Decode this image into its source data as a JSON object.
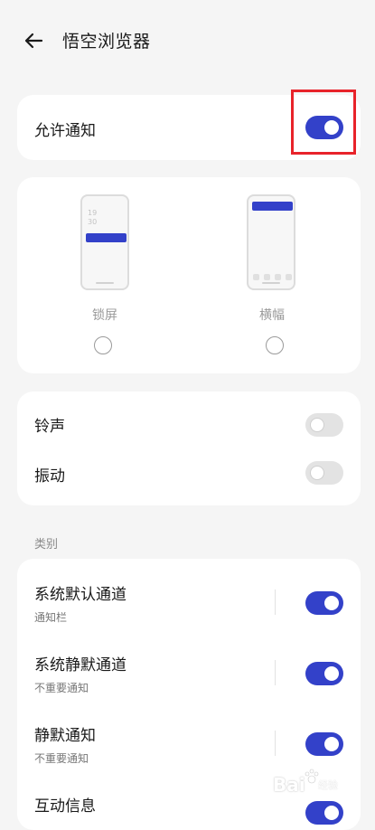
{
  "header": {
    "title": "悟空浏览器"
  },
  "allow_notifications": {
    "label": "允许通知",
    "enabled": true
  },
  "styles": [
    {
      "label": "锁屏",
      "selected": false,
      "clock_hour": "19",
      "clock_min": "30"
    },
    {
      "label": "横幅",
      "selected": false
    }
  ],
  "sound_vibration": [
    {
      "label": "铃声",
      "enabled": false
    },
    {
      "label": "振动",
      "enabled": false
    }
  ],
  "category": {
    "title": "类别",
    "items": [
      {
        "label": "系统默认通道",
        "sub": "通知栏",
        "enabled": true
      },
      {
        "label": "系统静默通道",
        "sub": "不重要通知",
        "enabled": true
      },
      {
        "label": "静默通知",
        "sub": "不重要通知",
        "enabled": true
      },
      {
        "label": "互动信息",
        "sub": "",
        "enabled": true
      }
    ]
  },
  "watermark": {
    "brand": "Bai",
    "suffix": "经验"
  },
  "colors": {
    "accent": "#3341c9",
    "highlight": "#e8232a"
  }
}
